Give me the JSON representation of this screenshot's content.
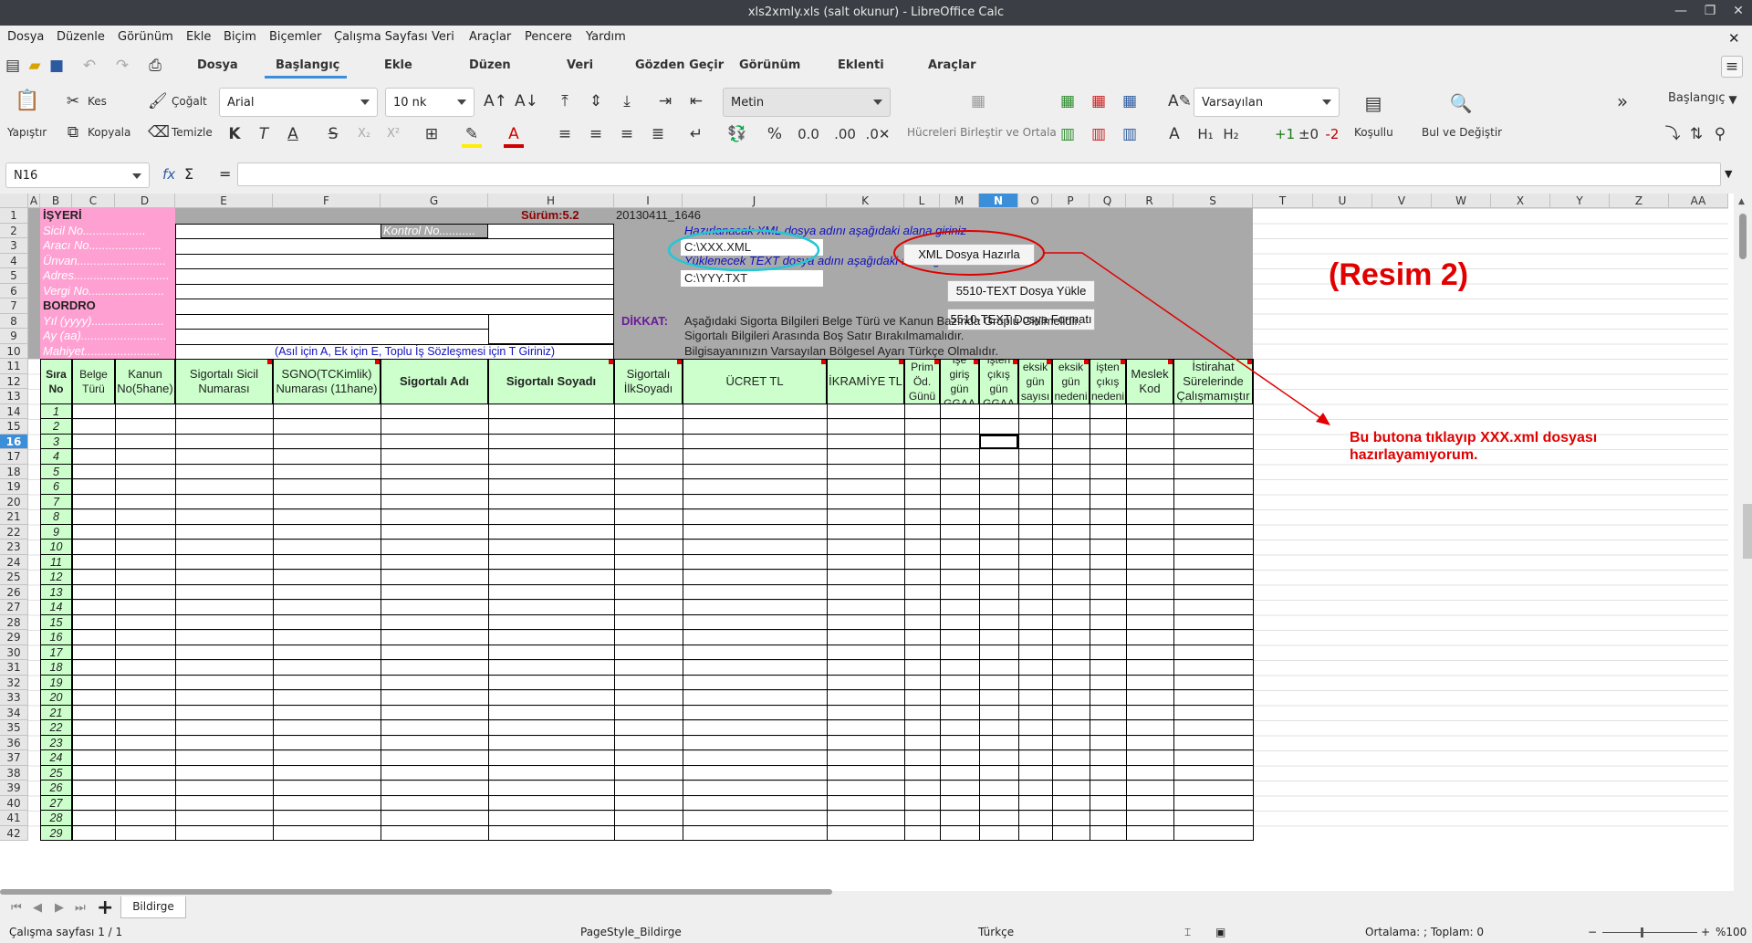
{
  "window": {
    "title": "xls2xmly.xls (salt okunur) - LibreOffice Calc"
  },
  "menu": [
    "Dosya",
    "Düzenle",
    "Görünüm",
    "Ekle",
    "Biçim",
    "Biçemler",
    "Çalışma Sayfası",
    "Veri",
    "Araçlar",
    "Pencere",
    "Yardım"
  ],
  "tabs": [
    "Dosya",
    "Başlangıç",
    "Ekle",
    "Düzen",
    "Veri",
    "Gözden Geçir",
    "Görünüm",
    "Eklenti",
    "Araçlar"
  ],
  "active_tab": "Başlangıç",
  "ribbon": {
    "paste": "Yapıştır",
    "cut": "Kes",
    "copy": "Kopyala",
    "clone": "Çoğalt",
    "clear": "Temizle",
    "font_name": "Arial",
    "font_size": "10 nk",
    "number_format": "Metin",
    "merge": "Hücreleri Birleştir ve Ortala",
    "style": "Varsayılan",
    "conditional": "Koşullu",
    "find_replace": "Bul ve Değiştir",
    "more": "»",
    "context": "Başlangıç"
  },
  "formula": {
    "name_box": "N16",
    "fx": "fx",
    "sigma": "Σ",
    "eq": "=",
    "content": ""
  },
  "columns": [
    "A",
    "B",
    "C",
    "D",
    "E",
    "F",
    "G",
    "H",
    "I",
    "J",
    "K",
    "L",
    "M",
    "N",
    "O",
    "P",
    "Q",
    "R",
    "S",
    "T",
    "U",
    "V",
    "W",
    "X",
    "Y",
    "Z",
    "AA"
  ],
  "selected_column": "N",
  "rows": [
    "1",
    "2",
    "3",
    "4",
    "5",
    "6",
    "7",
    "8",
    "9",
    "10",
    "11",
    "12",
    "13",
    "14",
    "15",
    "16",
    "17",
    "18",
    "19",
    "20",
    "21",
    "22",
    "23",
    "24",
    "25",
    "26",
    "27",
    "28",
    "29",
    "30",
    "31",
    "32",
    "33",
    "34",
    "35",
    "36",
    "37",
    "38",
    "39",
    "40",
    "41",
    "42"
  ],
  "selected_row": "16",
  "form": {
    "isyeri": "İŞYERİ",
    "version": "Sürüm:5.2",
    "build": "20130411_1646",
    "sicil": "Sicil No...................",
    "kontrol": "Kontrol No...........",
    "araci": "Aracı No......................",
    "unvan": "Ünvan...........................",
    "adres": "Adres.............................",
    "vergi": "Vergi No.......................",
    "bordro": "BORDRO",
    "yil": "Yıl (yyyy)......................",
    "ay": "Ay (aa)..........................",
    "mahiyet": "Mahiyet.......................",
    "mahiyet_note": "(Asıl için A, Ek için E, Toplu İş Sözleşmesi için T Giriniz)",
    "xml_prompt": "Hazırlanacak XML dosya adını aşağıdaki alana giriniz",
    "xml_value": "C:\\XXX.XML",
    "text_prompt": "Yüklenecek TEXT dosya adını aşağıdaki alana giriniz",
    "text_value": "C:\\YYY.TXT",
    "btn_xml": "XML Dosya Hazırla",
    "btn_text_load": "5510-TEXT Dosya Yükle",
    "btn_text_format": "5510-TEXT Dosya Formatı",
    "dikkat": "DİKKAT:",
    "note1": "Aşağıdaki Sigorta Bilgileri Belge Türü ve Kanun Bazında Gruplu Girilmelidir.",
    "note2": "Sigortalı Bilgileri Arasında Boş Satır Bırakılmamalıdır.",
    "note3": "Bilgisayanınızın Varsayılan Bölgesel Ayarı Türkçe Olmalıdır."
  },
  "table_headers": [
    "Sıra No",
    "Belge Türü",
    "Kanun No(5hane)",
    "Sigortalı Sicil Numarası",
    "SGNO(TCKimlik) Numarası (11hane)",
    "Sigortalı Adı",
    "Sigortalı Soyadı",
    "Sigortalı İlkSoyadı",
    "ÜCRET TL",
    "İKRAMİYE TL",
    "Prim Öd. Günü",
    "işe giriş gün GGAA",
    "işten çıkış gün GGAA",
    "eksik gün sayısı",
    "eksik gün nedeni",
    "işten çıkış nedeni",
    "Meslek Kod",
    "İstirahat Sürelerinde Çalışmamıştır"
  ],
  "sira": [
    "1",
    "2",
    "3",
    "4",
    "5",
    "6",
    "7",
    "8",
    "9",
    "10",
    "11",
    "12",
    "13",
    "14",
    "15",
    "16",
    "17",
    "18",
    "19",
    "20",
    "21",
    "22",
    "23",
    "24",
    "25",
    "26",
    "27",
    "28",
    "29"
  ],
  "annotation": {
    "title": "(Resim 2)",
    "text1": "Bu butona tıklayıp XXX.xml dosyası",
    "text2": "hazırlayamıyorum."
  },
  "sheet": {
    "tab": "Bildirge",
    "add": "+"
  },
  "status": {
    "sheet": "Çalışma sayfası 1 / 1",
    "page_style": "PageStyle_Bildirge",
    "language": "Türkçe",
    "sum": "Ortalama: ; Toplam: 0",
    "zoom": "%100"
  },
  "colors": {
    "accent": "#3b8fd9",
    "pink": "#ffa0d2",
    "gray": "#a9a9a9",
    "green": "#ccffcc",
    "annotation_red": "#e00000",
    "cyan_ellipse": "#22c7d6"
  }
}
